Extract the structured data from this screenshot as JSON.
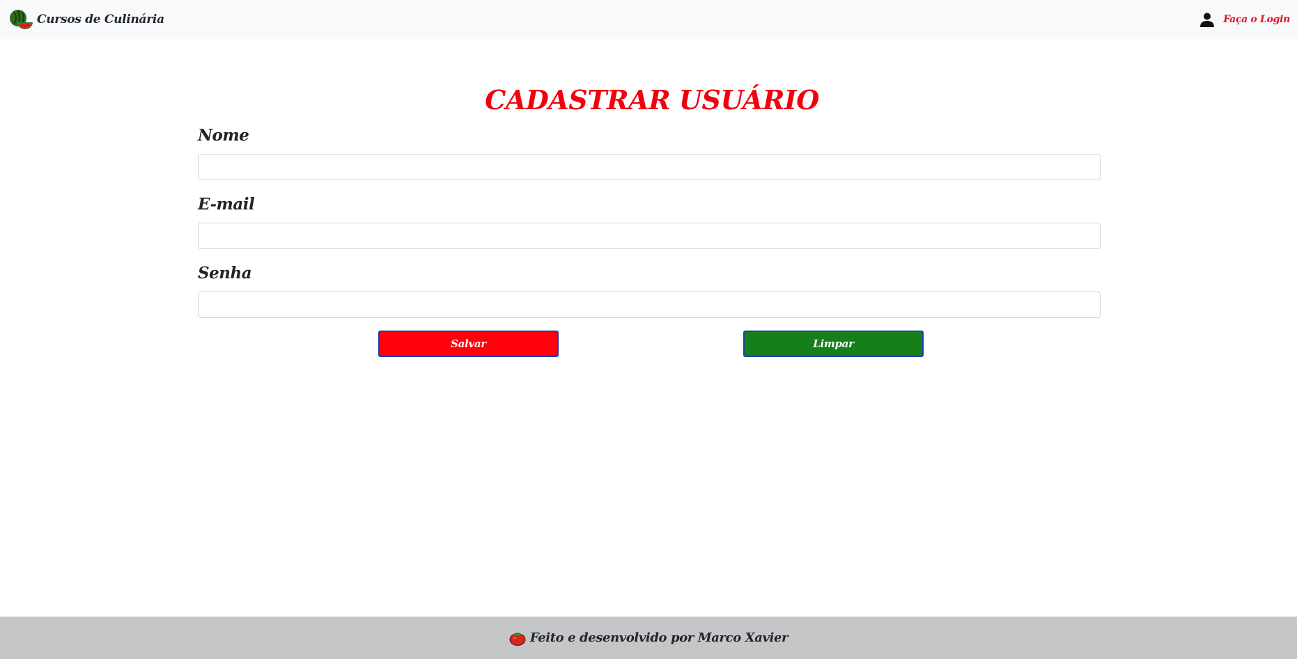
{
  "navbar": {
    "brand_label": "Cursos de Culinária",
    "brand_icon": "watermelon-icon",
    "login_label": "Faça o Login",
    "login_icon": "user-icon"
  },
  "form": {
    "title": "CADASTRAR USUÁRIO",
    "fields": [
      {
        "label": "Nome",
        "value": "",
        "placeholder": ""
      },
      {
        "label": "E-mail",
        "value": "",
        "placeholder": ""
      },
      {
        "label": "Senha",
        "value": "",
        "placeholder": ""
      }
    ],
    "save_label": "Salvar",
    "clear_label": "Limpar"
  },
  "footer": {
    "icon": "tomato-icon",
    "text": "Feito e desenvolvido por Marco Xavier"
  },
  "colors": {
    "title": "#f2000f",
    "save_button": "#ff000c",
    "clear_button": "#15801a",
    "button_border": "#1a3fb5",
    "login_link": "#e0141e",
    "navbar_bg": "#f8f9fa",
    "footer_bg": "#c5c6c8"
  }
}
